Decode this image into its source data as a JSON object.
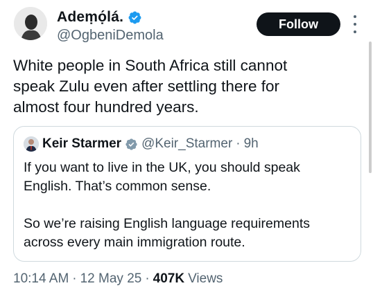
{
  "colors": {
    "verified_badge": "#1d9bf0",
    "follow_button_bg": "#0f1419",
    "secondary_text": "#536471",
    "border": "#cfd9de"
  },
  "author": {
    "display_name": "Adeṃọ́lá.",
    "handle": "@OgbeniDemola",
    "verified": true,
    "avatar_icon": "profile-photo"
  },
  "follow_button": {
    "label": "Follow"
  },
  "tweet": {
    "text": "White people in South Africa still cannot\nspeak Zulu even after settling there for\nalmost four hundred years."
  },
  "quoted_tweet": {
    "display_name": "Keir Starmer",
    "handle": "@Keir_Starmer",
    "separator": "·",
    "time": "9h",
    "verified": true,
    "text": "If you want to live in the UK, you should speak\nEnglish. That’s common sense.\n\nSo we’re raising English language requirements\nacross every main immigration route."
  },
  "meta": {
    "time": "10:14 AM",
    "sep1": "·",
    "date": "12 May 25",
    "sep2": "·",
    "views_count": "407K",
    "views_label": "Views"
  }
}
